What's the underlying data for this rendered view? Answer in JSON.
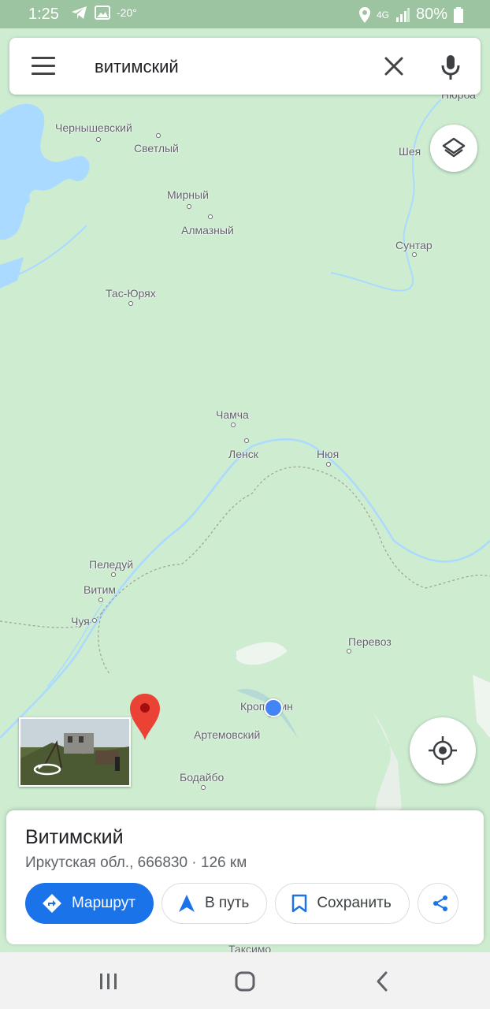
{
  "status_bar": {
    "time": "1:25",
    "temperature": "-20°",
    "network": "4G",
    "battery": "80%"
  },
  "search": {
    "query": "витимский"
  },
  "map_labels": [
    {
      "name": "Чернышевский"
    },
    {
      "name": "Светлый"
    },
    {
      "name": "Мирный"
    },
    {
      "name": "Алмазный"
    },
    {
      "name": "Шея"
    },
    {
      "name": "Сунтар"
    },
    {
      "name": "Тас-Юрях"
    },
    {
      "name": "Чамча"
    },
    {
      "name": "Ленск"
    },
    {
      "name": "Нюя"
    },
    {
      "name": "Пеледуй"
    },
    {
      "name": "Витим"
    },
    {
      "name": "Чуя"
    },
    {
      "name": "Перевоз"
    },
    {
      "name": "Кропоткин"
    },
    {
      "name": "Артемовский"
    },
    {
      "name": "Бодайбо"
    },
    {
      "name": "Нюрба"
    },
    {
      "name": "Таксимо"
    }
  ],
  "place_card": {
    "name": "Витимский",
    "subtitle": "Иркутская обл., 666830 · 126 км",
    "actions": {
      "directions": "Маршрут",
      "start": "В путь",
      "save": "Сохранить"
    }
  },
  "colors": {
    "map_green": "#cdecd0",
    "water": "#aadaff",
    "accent_blue": "#1a73e8",
    "pin_red": "#ea4335",
    "my_location": "#4285f4"
  }
}
